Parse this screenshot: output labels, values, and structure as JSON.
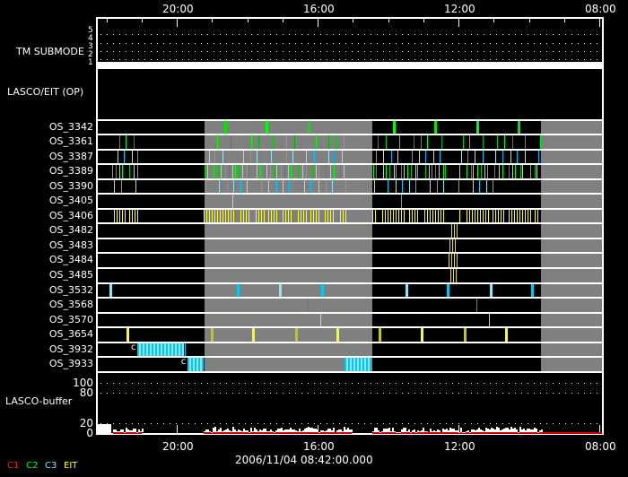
{
  "chart_data": {
    "type": "timeline",
    "x_axis": {
      "unit": "hour of day",
      "direction": "decreasing left to right",
      "range": [
        22.27,
        7.9
      ],
      "major_ticks": [
        {
          "hour": 20,
          "label": "20:00"
        },
        {
          "hour": 16,
          "label": "16:00"
        },
        {
          "hour": 12,
          "label": "12:00"
        },
        {
          "hour": 8,
          "label": "08:00"
        }
      ],
      "minor_tick_step_hours": 1
    },
    "date_label": "2006/11/04 08:42:00.000",
    "tm_submode": {
      "label": "TM SUBMODE",
      "levels": [
        "5",
        "4",
        "3",
        "2",
        "1"
      ],
      "value": 1
    },
    "section_label": "LASCO/EIT (OP)",
    "gaps": [
      [
        19.21,
        14.45
      ],
      [
        9.66,
        7.9
      ]
    ],
    "rows": [
      {
        "name": "OS_3342",
        "colors": [
          "#00e600",
          "#00ff00"
        ],
        "kind": "thick",
        "events": [
          18.62,
          17.43,
          16.23,
          13.83,
          12.64,
          11.46,
          10.27
        ]
      },
      {
        "name": "OS_3361",
        "colors": [
          "#00d000",
          "#00ff00",
          "#00b400"
        ],
        "kind": "thin",
        "events": [
          21.63,
          21.45,
          21.22,
          19.06,
          18.85,
          18.45,
          18.06,
          17.86,
          17.66,
          17.25,
          16.87,
          16.66,
          16.46,
          16.05,
          15.67,
          15.47,
          15.26,
          14.27,
          14.06,
          13.68,
          13.27,
          13.07,
          12.87,
          12.48,
          11.87,
          11.67,
          11.29,
          10.88,
          10.68,
          10.47,
          10.09,
          9.68
        ]
      },
      {
        "name": "OS_3387",
        "colors": [
          "#8ee4f0",
          "#00c8ff",
          "#a0e8f0",
          "#00b4f0"
        ],
        "kind": "thin",
        "events": [
          21.68,
          21.48,
          21.27,
          21.1,
          19.08,
          18.91,
          18.7,
          18.5,
          18.09,
          17.89,
          17.71,
          17.5,
          17.3,
          16.89,
          16.69,
          16.51,
          16.31,
          16.1,
          15.69,
          15.52,
          15.31,
          14.32,
          14.12,
          13.91,
          13.71,
          13.3,
          13.12,
          12.92,
          12.71,
          12.51,
          11.92,
          11.72,
          11.52,
          11.31,
          10.93,
          10.73,
          10.52,
          10.32,
          10.11,
          9.73
        ]
      },
      {
        "name": "OS_3389",
        "colors": [
          "#00ff00",
          "#00c800",
          "#c8c8c8"
        ],
        "kind": "thin",
        "events": [
          21.81,
          21.73,
          21.61,
          21.53,
          21.33,
          21.2,
          21.12,
          19.21,
          19.13,
          18.93,
          18.8,
          18.73,
          18.62,
          18.52,
          18.42,
          18.34,
          18.22,
          18.14,
          18.01,
          17.94,
          17.73,
          17.61,
          17.5,
          17.43,
          17.35,
          17.22,
          17.15,
          17.02,
          16.94,
          16.82,
          16.74,
          16.54,
          16.43,
          16.33,
          16.15,
          16.03,
          15.95,
          15.75,
          15.62,
          15.54,
          15.34,
          15.24,
          14.42,
          14.34,
          14.14,
          14.04,
          13.96,
          13.83,
          13.76,
          13.63,
          13.55,
          13.43,
          13.35,
          13.22,
          13.15,
          12.94,
          12.84,
          12.76,
          12.64,
          12.56,
          12.43,
          12.36,
          11.95,
          11.75,
          11.64,
          11.57,
          11.44,
          11.36,
          11.24,
          11.16,
          10.96,
          10.85,
          10.75,
          10.57,
          10.45,
          10.37,
          10.24,
          10.17,
          9.96,
          9.83,
          9.76
        ]
      },
      {
        "name": "OS_3390",
        "colors": [
          "#8ee4f0",
          "#00c8ff"
        ],
        "kind": "thin",
        "events": [
          21.76,
          21.56,
          21.17,
          19.16,
          18.78,
          18.57,
          18.37,
          18.17,
          17.99,
          17.58,
          17.38,
          17.17,
          16.97,
          16.79,
          16.38,
          16.18,
          15.97,
          15.77,
          15.59,
          15.19,
          14.39,
          13.99,
          13.78,
          13.58,
          13.4,
          13.2,
          12.79,
          12.59,
          12.41,
          12.0,
          11.59,
          11.39,
          11.21,
          11.01
        ]
      },
      {
        "name": "OS_3405",
        "colors": [
          "#8ee4f0",
          "#00c8ff"
        ],
        "kind": "thin",
        "events": [
          18.4,
          13.63
        ]
      },
      {
        "name": "OS_3406",
        "colors": [
          "#ffff00"
        ],
        "kind": "burst",
        "bursts": [
          [
            21.78,
            21.42
          ],
          [
            21.35,
            21.07
          ],
          [
            19.24,
            18.32
          ],
          [
            18.19,
            17.89
          ],
          [
            17.76,
            17.48
          ],
          [
            17.4,
            17.12
          ],
          [
            16.99,
            16.69
          ],
          [
            16.56,
            16.28
          ],
          [
            16.2,
            15.92
          ],
          [
            15.79,
            15.49
          ],
          [
            15.36,
            15.16
          ],
          [
            14.45,
            14.29
          ],
          [
            14.17,
            13.53
          ],
          [
            13.4,
            13.09
          ],
          [
            12.97,
            12.38
          ],
          [
            11.97,
            11.9
          ],
          [
            11.77,
            11.13
          ],
          [
            11.03,
            10.7
          ],
          [
            10.57,
            9.94
          ],
          [
            9.83,
            9.68
          ]
        ]
      },
      {
        "name": "OS_3482",
        "colors": [
          "#e6e600"
        ],
        "kind": "burst",
        "bursts": [
          [
            12.2,
            11.97
          ]
        ]
      },
      {
        "name": "OS_3483",
        "colors": [
          "#e6e600"
        ],
        "kind": "burst",
        "bursts": [
          [
            12.25,
            12.02
          ]
        ]
      },
      {
        "name": "OS_3484",
        "colors": [
          "#e6e600"
        ],
        "kind": "burst",
        "bursts": [
          [
            12.28,
            12.02
          ]
        ]
      },
      {
        "name": "OS_3485",
        "colors": [
          "#e6e600"
        ],
        "kind": "burst",
        "bursts": [
          [
            12.23,
            11.99
          ]
        ]
      },
      {
        "name": "OS_3532",
        "colors": [
          "#8ee4f0",
          "#00c8f0"
        ],
        "kind": "thick",
        "events": [
          21.86,
          18.25,
          17.07,
          15.87,
          13.47,
          12.3,
          11.08,
          9.91
        ]
      },
      {
        "name": "OS_3568",
        "colors": [
          "#00c800"
        ],
        "kind": "thin",
        "events": [
          16.28,
          11.49
        ]
      },
      {
        "name": "OS_3570",
        "colors": [
          "#8ee4f0"
        ],
        "kind": "thin",
        "events": [
          15.9,
          11.13
        ]
      },
      {
        "name": "OS_3654",
        "colors": [
          "#ffff00",
          "#c8c800"
        ],
        "kind": "thick",
        "events": [
          21.4,
          18.99,
          17.81,
          16.61,
          15.42,
          14.22,
          13.02,
          11.82,
          10.63
        ]
      },
      {
        "name": "OS_3932",
        "colors": [
          "#00c8f0"
        ],
        "kind": "block",
        "marker": "c",
        "bursts": [
          [
            21.12,
            19.79
          ]
        ],
        "events": [
          19.76
        ]
      },
      {
        "name": "OS_3933",
        "colors": [
          "#00c8f0"
        ],
        "kind": "block",
        "marker": "c",
        "bursts": [
          [
            19.7,
            19.24
          ],
          [
            15.24,
            14.48
          ]
        ]
      }
    ],
    "buffer": {
      "label": "LASCO-buffer",
      "ylim": [
        0,
        100
      ],
      "y_ticks": [
        "100",
        "80",
        "20",
        "0"
      ],
      "y_tick_values": [
        100,
        80,
        20,
        0
      ],
      "segments": [
        {
          "range": [
            22.27,
            21.85
          ],
          "level": 18,
          "solid": true
        },
        {
          "range": [
            21.81,
            20.99
          ],
          "level": 12
        },
        {
          "range": [
            19.24,
            15.03
          ],
          "level": 12
        },
        {
          "range": [
            14.45,
            9.66
          ],
          "level": 12
        }
      ]
    },
    "legend": [
      {
        "label": "C1",
        "color": "#ff2020"
      },
      {
        "label": "C2",
        "color": "#00ff00"
      },
      {
        "label": "C3",
        "color": "#8ee4f0"
      },
      {
        "label": "EIT",
        "color": "#ffff00"
      }
    ]
  }
}
